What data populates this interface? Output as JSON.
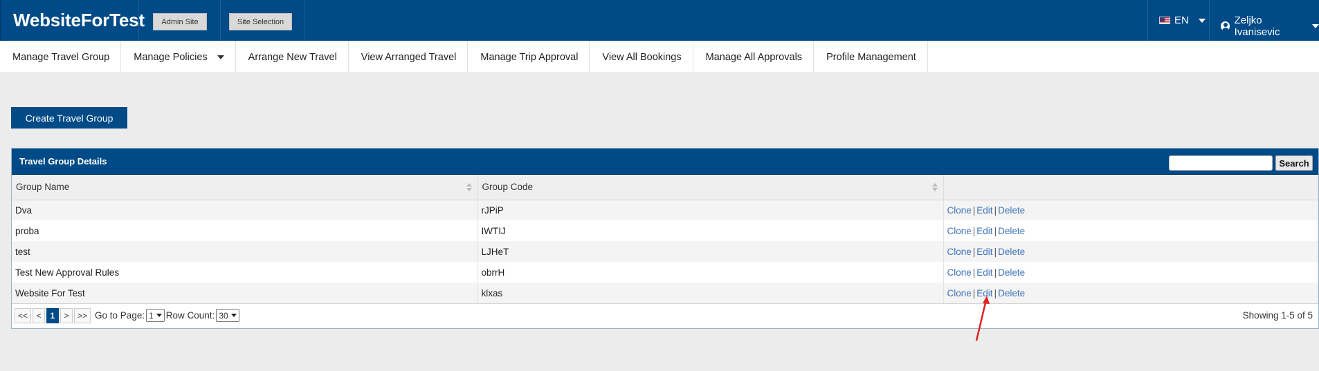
{
  "header": {
    "brand": "WebsiteForTest",
    "admin_site": "Admin Site",
    "site_selection": "Site Selection",
    "language": "EN",
    "user_name": "Zeljko Ivanisevic"
  },
  "nav": [
    {
      "label": "Manage Travel Group"
    },
    {
      "label": "Manage Policies",
      "dropdown": true
    },
    {
      "label": "Arrange New Travel"
    },
    {
      "label": "View Arranged Travel"
    },
    {
      "label": "Manage Trip Approval"
    },
    {
      "label": "View All Bookings"
    },
    {
      "label": "Manage All Approvals"
    },
    {
      "label": "Profile Management"
    }
  ],
  "create_button": "Create Travel Group",
  "panel": {
    "title": "Travel Group Details",
    "search_button": "Search",
    "search_value": "",
    "columns": [
      "Group Name",
      "Group Code",
      ""
    ],
    "rows": [
      {
        "name": "Dva",
        "code": "rJPiP"
      },
      {
        "name": "proba",
        "code": "IWTIJ"
      },
      {
        "name": "test",
        "code": "LJHeT"
      },
      {
        "name": "Test New Approval Rules",
        "code": "obrrH"
      },
      {
        "name": "Website For Test",
        "code": "klxas"
      }
    ],
    "actions": {
      "clone": "Clone",
      "edit": "Edit",
      "delete": "Delete",
      "separator": "|"
    }
  },
  "pager": {
    "first": "<<",
    "prev": "<",
    "current": "1",
    "next": ">",
    "last": ">>",
    "goto_label": "Go to Page:",
    "goto_value": "1",
    "row_count_label": "Row Count:",
    "row_count_value": "30",
    "showing": "Showing 1-5 of 5"
  },
  "colors": {
    "brand": "#004a87",
    "link": "#3d73b9",
    "annotation_arrow": "#e02020"
  }
}
